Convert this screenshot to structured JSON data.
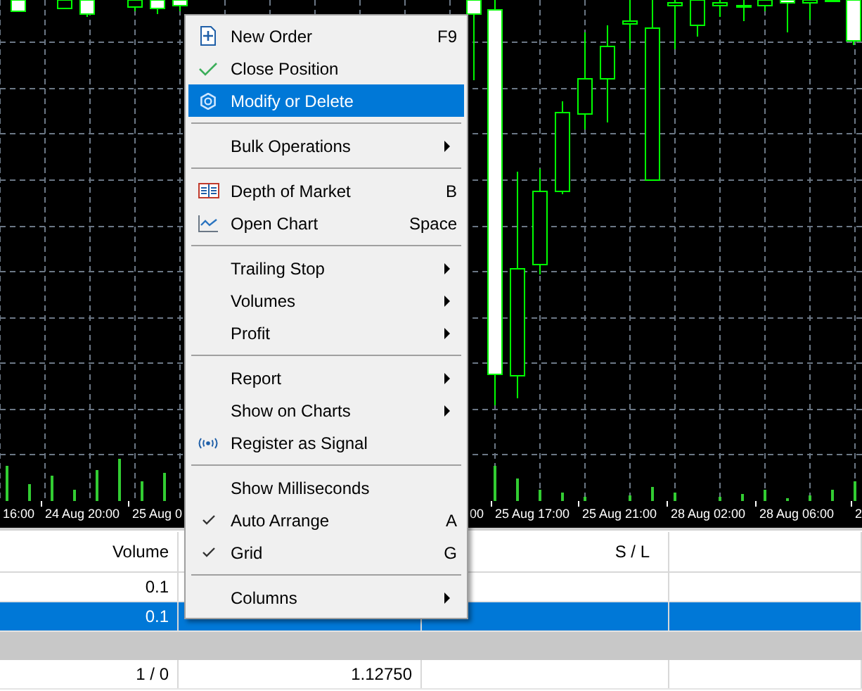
{
  "chart": {
    "time_labels": [
      {
        "text": "16:00"
      },
      {
        "text": "24 Aug 20:00"
      },
      {
        "text": "25 Aug 0"
      },
      {
        "text": "00"
      },
      {
        "text": "25 Aug 17:00"
      },
      {
        "text": "25 Aug 21:00"
      },
      {
        "text": "28 Aug 02:00"
      },
      {
        "text": "28 Aug 06:00"
      },
      {
        "text": "2"
      }
    ]
  },
  "table": {
    "header": {
      "column_1": "Volume",
      "column_3": "S / L"
    },
    "rows": [
      {
        "kind": "position",
        "selected": false,
        "column_1": "0.1"
      },
      {
        "kind": "position",
        "selected": true,
        "column_1": "0.1"
      },
      {
        "kind": "band",
        "selected": false
      },
      {
        "kind": "total",
        "selected": false,
        "column_1": "1 / 0",
        "column_2": "1.12750"
      }
    ]
  },
  "context_menu": {
    "sections": [
      [
        {
          "label": "New Order",
          "shortcut": "F9",
          "submenu": false,
          "checked": false,
          "selected": false
        },
        {
          "label": "Close Position",
          "submenu": false,
          "checked": false,
          "selected": false
        },
        {
          "label": "Modify or Delete",
          "submenu": false,
          "checked": false,
          "selected": true
        }
      ],
      [
        {
          "label": "Bulk Operations",
          "submenu": true,
          "checked": false,
          "selected": false
        }
      ],
      [
        {
          "label": "Depth of Market",
          "shortcut": "B",
          "submenu": false,
          "checked": false,
          "selected": false
        },
        {
          "label": "Open Chart",
          "shortcut": "Space",
          "submenu": false,
          "checked": false,
          "selected": false
        }
      ],
      [
        {
          "label": "Trailing Stop",
          "submenu": true,
          "checked": false,
          "selected": false
        },
        {
          "label": "Volumes",
          "submenu": true,
          "checked": false,
          "selected": false
        },
        {
          "label": "Profit",
          "submenu": true,
          "checked": false,
          "selected": false
        }
      ],
      [
        {
          "label": "Report",
          "submenu": true,
          "checked": false,
          "selected": false
        },
        {
          "label": "Show on Charts",
          "submenu": true,
          "checked": false,
          "selected": false
        },
        {
          "label": "Register as Signal",
          "submenu": false,
          "checked": false,
          "selected": false
        }
      ],
      [
        {
          "label": "Show Milliseconds",
          "submenu": false,
          "checked": false,
          "selected": false
        },
        {
          "label": "Auto Arrange",
          "shortcut": "A",
          "submenu": false,
          "checked": true,
          "selected": false
        },
        {
          "label": "Grid",
          "shortcut": "G",
          "submenu": false,
          "checked": true,
          "selected": false
        }
      ],
      [
        {
          "label": "Columns",
          "submenu": true,
          "checked": false,
          "selected": false
        }
      ]
    ]
  }
}
